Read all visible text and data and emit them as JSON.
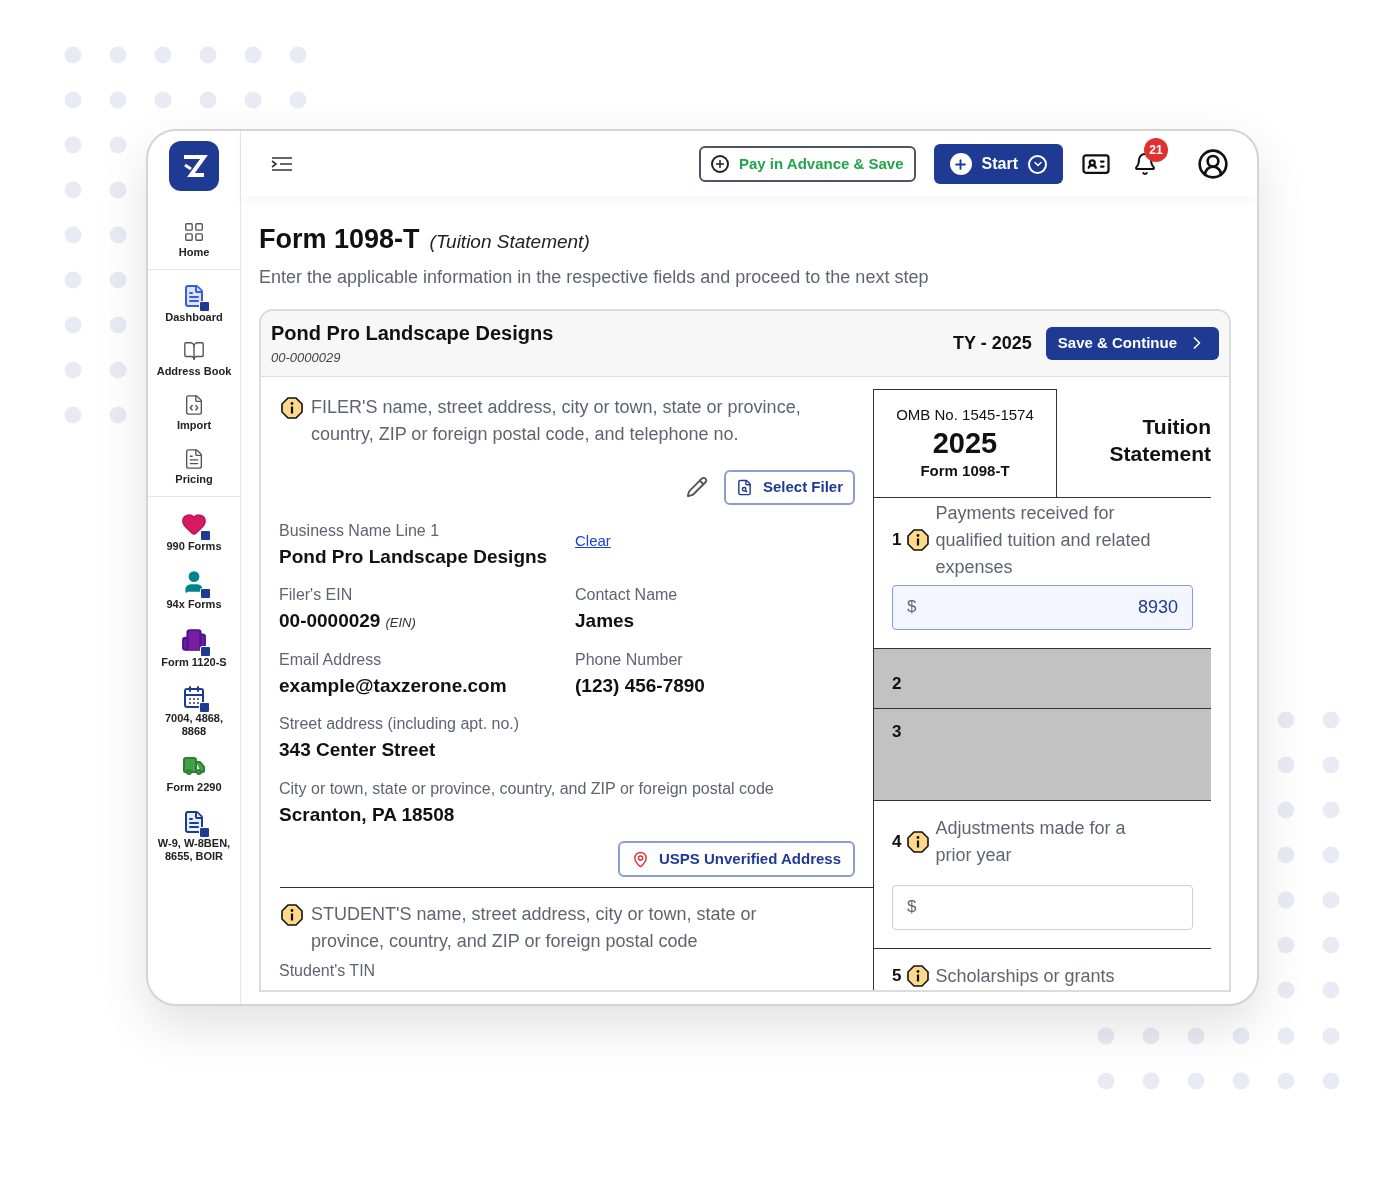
{
  "sidebar": {
    "groups": [
      [
        {
          "label": "Home"
        }
      ],
      [
        {
          "label": "Dashboard"
        },
        {
          "label": "Address Book"
        },
        {
          "label": "Import"
        },
        {
          "label": "Pricing"
        }
      ],
      [
        {
          "label": "990 Forms"
        },
        {
          "label": "94x Forms"
        },
        {
          "label": "Form 1120-S"
        },
        {
          "label": "7004, 4868, 8868"
        },
        {
          "label": "Form 2290"
        },
        {
          "label": "W-9, W-8BEN, 8655, BOIR"
        }
      ]
    ]
  },
  "header": {
    "pay_button": "Pay in Advance & Save",
    "start_button": "Start",
    "notification_count": "21"
  },
  "page": {
    "title": "Form 1098-T",
    "subtitle": "(Tuition Statement)",
    "description": "Enter the applicable information in the respective fields and proceed to the next step"
  },
  "card": {
    "name": "Pond Pro Landscape Designs",
    "id": "00-0000029",
    "tax_year": "TY - 2025",
    "save_button": "Save & Continue"
  },
  "filer": {
    "heading": "FILER'S name, street address, city or town, state or province, country, ZIP or foreign postal code, and telephone no.",
    "select_button": "Select Filer",
    "clear_link": "Clear",
    "rows": [
      [
        {
          "label": "Business Name Line 1",
          "value": "Pond Pro Landscape Designs"
        }
      ],
      [
        {
          "label": "Filer's EIN",
          "value": "00-0000029",
          "suffix": "(EIN)"
        },
        {
          "label": "Contact Name",
          "value": "James"
        }
      ],
      [
        {
          "label": "Email Address",
          "value": "example@taxzerone.com"
        },
        {
          "label": "Phone Number",
          "value": "(123) 456-7890"
        }
      ],
      [
        {
          "label": "Street address (including apt. no.)",
          "value": "343 Center Street"
        }
      ],
      [
        {
          "label": "City or town, state or province, country, and ZIP or foreign postal code",
          "value": "Scranton, PA 18508"
        }
      ]
    ],
    "usps_button": "USPS Unverified Address"
  },
  "student": {
    "heading": "STUDENT'S name, street address, city or town, state or province, country, and ZIP or foreign postal code",
    "tin_label": "Student's TIN"
  },
  "form": {
    "omb": "OMB No. 1545-1574",
    "year": "2025",
    "form_name": "Form 1098-T",
    "title": "Tuition Statement",
    "boxes": [
      {
        "number": "1",
        "kind": "amount",
        "label": "Payments received for qualified tuition and related expenses",
        "currency": "$",
        "value": "8930",
        "focused": true
      },
      {
        "number": "2",
        "kind": "disabled"
      },
      {
        "number": "3",
        "kind": "disabled"
      },
      {
        "number": "4",
        "kind": "amount",
        "label": "Adjustments made for a prior year",
        "currency": "$",
        "focused": false
      },
      {
        "number": "5",
        "kind": "amount",
        "label": "Scholarships or grants"
      }
    ]
  }
}
